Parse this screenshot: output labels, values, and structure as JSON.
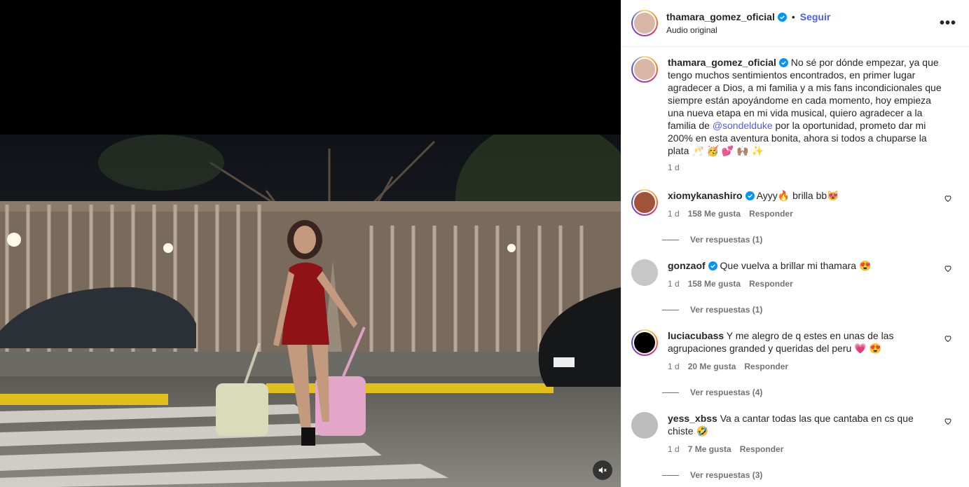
{
  "header": {
    "username": "thamara_gomez_oficial",
    "separator": "•",
    "follow_label": "Seguir",
    "audio": "Audio original",
    "more_label": "•••"
  },
  "caption": {
    "username": "thamara_gomez_oficial",
    "text_before": " No sé por dónde empezar, ya que tengo muchos sentimientos encontrados, en primer lugar agradecer a Dios, a mi familia y a mis fans incondicionales que siempre están apoyándome en cada momento, hoy empieza una nueva etapa en mi vida musical, quiero agradecer a la familia de ",
    "mention": "@sondelduke",
    "text_after": " por la oportunidad, prometo dar mi 200% en esta aventura bonita, ahora si todos a chuparse la plata 🥂 🥳 💕 🙌🏽 ✨",
    "time": "1 d"
  },
  "comments": [
    {
      "username": "xiomykanashiro",
      "text": " Ayyy🔥 brilla bb😻",
      "time": "1 d",
      "likes": "158 Me gusta",
      "reply": "Responder",
      "replies": "Ver respuestas (1)"
    },
    {
      "username": "gonzaof",
      "text": " Que vuelva a brillar mi thamara 😍",
      "time": "1 d",
      "likes": "158 Me gusta",
      "reply": "Responder",
      "replies": "Ver respuestas (1)"
    },
    {
      "username": "luciacubass",
      "text": " Y me alegro de q estes en unas de las agrupaciones granded y queridas del peru 💗 😍",
      "time": "1 d",
      "likes": "20 Me gusta",
      "reply": "Responder",
      "replies": "Ver respuestas (4)"
    },
    {
      "username": "yess_xbss",
      "text": " Va a cantar todas las que cantaba en cs que chiste 🤣",
      "time": "1 d",
      "likes": "7 Me gusta",
      "reply": "Responder",
      "replies": "Ver respuestas (3)"
    }
  ],
  "colors": {
    "link": "#4a5df9",
    "verified": "#0095f6",
    "muted": "#737373"
  },
  "icons": {
    "mute": "speaker-muted-icon",
    "like": "heart-outline-icon",
    "verified": "verified-badge-icon"
  }
}
